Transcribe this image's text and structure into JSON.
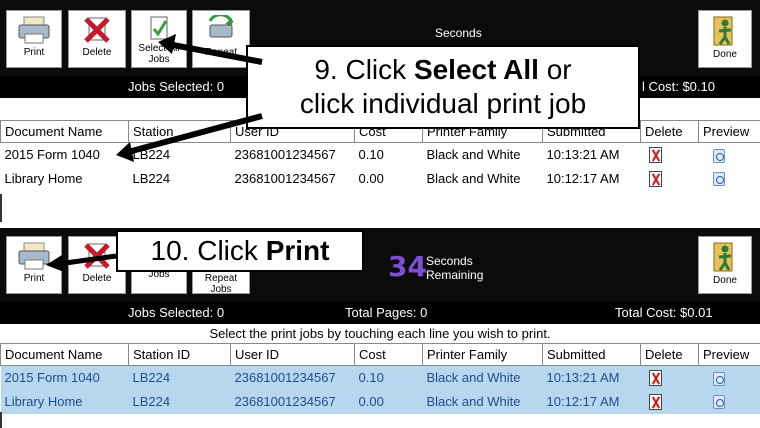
{
  "panel1": {
    "toolbar": {
      "print_label": "Print",
      "delete_label": "Delete",
      "select_all_label": "Select All Jobs",
      "repeat_label": "Repeat",
      "done_label": "Done",
      "timer_text": "Seconds"
    },
    "info": {
      "jobs_selected": "Jobs Selected: 0",
      "total_cost": "l Cost: $0.10"
    },
    "callout": {
      "line1_pre": "9. Click ",
      "line1_bold": "Select All",
      "line1_post": " or",
      "line2": "click individual print job"
    },
    "columns": [
      "Document Name",
      "Station",
      "User ID",
      "Cost",
      "Printer Family",
      "Submitted",
      "Delete",
      "Preview"
    ],
    "rows": [
      {
        "doc": "2015 Form 1040",
        "station": "LB224",
        "user": "23681001234567",
        "cost": "0.10",
        "family": "Black and White",
        "submitted": "10:13:21 AM"
      },
      {
        "doc": "Library Home",
        "station": "LB224",
        "user": "23681001234567",
        "cost": "0.00",
        "family": "Black and White",
        "submitted": "10:12:17 AM"
      }
    ]
  },
  "panel2": {
    "toolbar": {
      "print_label": "Print",
      "delete_label": "Delete",
      "select_all_label": "Jobs",
      "repeat_label": "Repeat Jobs",
      "done_label": "Done",
      "timer_number": "34",
      "timer_line1": "Seconds",
      "timer_line2": "Remaining"
    },
    "info": {
      "jobs_selected": "Jobs Selected: 0",
      "total_pages": "Total Pages: 0",
      "total_cost": "Total Cost: $0.01"
    },
    "instruction": "Select the print jobs by touching each line you wish to print.",
    "callout": {
      "pre": "10. Click ",
      "bold": "Print"
    },
    "columns": [
      "Document Name",
      "Station ID",
      "User ID",
      "Cost",
      "Printer Family",
      "Submitted",
      "Delete",
      "Preview"
    ],
    "rows": [
      {
        "doc": "2015 Form 1040",
        "station": "LB224",
        "user": "23681001234567",
        "cost": "0.10",
        "family": "Black and White",
        "submitted": "10:13:21 AM"
      },
      {
        "doc": "Library Home",
        "station": "LB224",
        "user": "23681001234567",
        "cost": "0.00",
        "family": "Black and White",
        "submitted": "10:12:17 AM"
      }
    ]
  },
  "icons": {
    "print": "printer-icon",
    "delete": "delete-x-icon",
    "select_all": "checklist-icon",
    "repeat": "repeat-icon",
    "done": "person-exit-icon",
    "row_delete": "red-x-icon",
    "row_preview": "preview-icon"
  },
  "colors": {
    "timer": "#7a4fd6",
    "selected_row": "#b6d7ee",
    "selected_text": "#1e4f8c",
    "toolbar": "#0b0b0b"
  }
}
